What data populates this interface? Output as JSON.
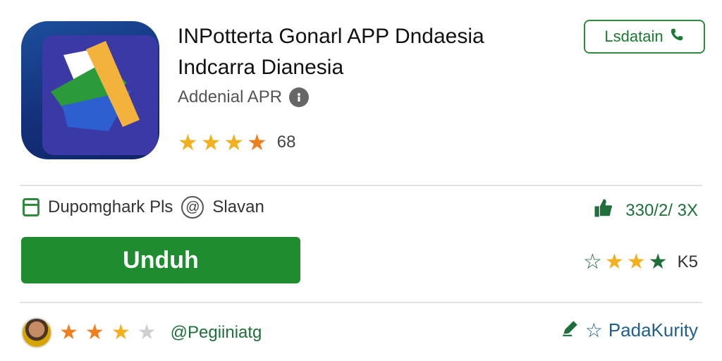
{
  "app": {
    "title_line1": "INPotterta Gonarl APP Dndaesia",
    "title_line2": "Indcarra Dianesia",
    "developer": "Addenial APR",
    "rating_stars": 4.5,
    "rating_count": "68",
    "icon": "app-logo-icon"
  },
  "actions": {
    "install_label": "Lsdatain",
    "download_label": "Unduh"
  },
  "meta": {
    "left_text": "Dupomghark Pls",
    "at_text": "Slavan",
    "right_stat": "330/2/ 3X",
    "right_rating_label": "K5"
  },
  "footer": {
    "handle": "@Pegiiniatg",
    "right_label": "PadaKurity"
  },
  "colors": {
    "accent_green": "#1e8c2f",
    "star_gold": "#f2b01e",
    "star_orange": "#ee7f1f"
  }
}
